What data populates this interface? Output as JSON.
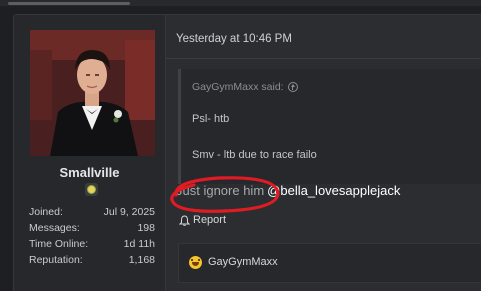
{
  "user": {
    "name": "Smallville",
    "stats": [
      {
        "label": "Joined:",
        "value": "Jul 9, 2025"
      },
      {
        "label": "Messages:",
        "value": "198"
      },
      {
        "label": "Time Online:",
        "value": "1d 11h"
      },
      {
        "label": "Reputation:",
        "value": "1,168"
      }
    ]
  },
  "post": {
    "timestamp": "Yesterday at 10:46 PM",
    "quote": {
      "author": "GayGymMaxx said:",
      "lines": [
        "Psl- htb",
        "Smv - ltb due to race failo"
      ]
    },
    "message_plain": "Just ignore him",
    "message_mention": "@bella_lovesapplejack",
    "report_label": "Report",
    "reaction_user": "GayGymMaxx"
  },
  "colors": {
    "annotation_circle": "#e01b24",
    "background": "#1d1f22",
    "post_bg": "#2b2d31"
  },
  "icons": {
    "quote_jump": "arrow-up-circle-icon",
    "report": "bell-icon",
    "reaction": "laughing-emoji-icon",
    "badge": "flower-badge-icon"
  }
}
